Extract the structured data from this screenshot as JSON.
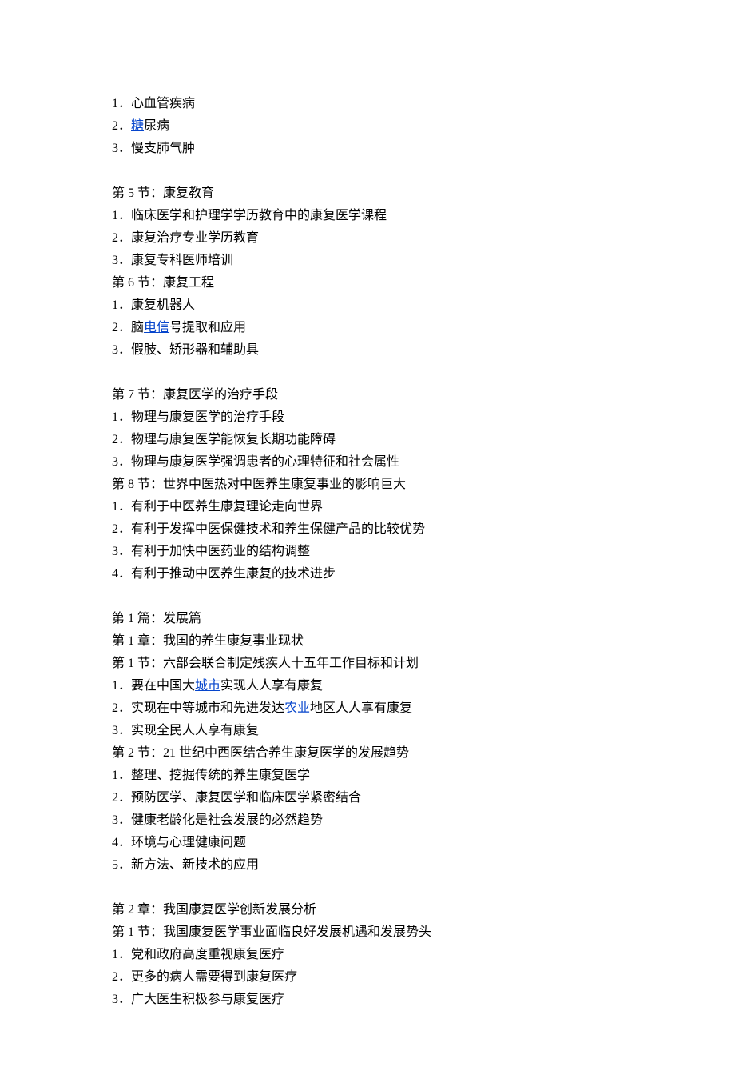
{
  "items": {
    "i1": {
      "pre": "1．",
      "text": "心血管疾病"
    },
    "i2": {
      "pre": "2．",
      "link": "糖",
      "text": "尿病"
    },
    "i3": {
      "pre": "3．",
      "text": "慢支肺气肿"
    },
    "s5": "第 5 节：康复教育",
    "s5_1": {
      "pre": "1．",
      "text": "临床医学和护理学学历教育中的康复医学课程"
    },
    "s5_2": {
      "pre": "2．",
      "text": "康复治疗专业学历教育"
    },
    "s5_3": {
      "pre": "3．",
      "text": "康复专科医师培训"
    },
    "s6": "第 6 节：康复工程",
    "s6_1": {
      "pre": "1．",
      "text": "康复机器人"
    },
    "s6_2": {
      "pre": "2．",
      "preText": "脑",
      "link": "电信",
      "text": "号提取和应用"
    },
    "s6_3": {
      "pre": "3．",
      "text": "假肢、矫形器和辅助具"
    },
    "s7": "第 7 节：康复医学的治疗手段",
    "s7_1": {
      "pre": "1．",
      "text": "物理与康复医学的治疗手段"
    },
    "s7_2": {
      "pre": "2．",
      "text": "物理与康复医学能恢复长期功能障碍"
    },
    "s7_3": {
      "pre": "3．",
      "text": "物理与康复医学强调患者的心理特征和社会属性"
    },
    "s8": "第 8 节：世界中医热对中医养生康复事业的影响巨大",
    "s8_1": {
      "pre": "1．",
      "text": "有利于中医养生康复理论走向世界"
    },
    "s8_2": {
      "pre": "2．",
      "text": "有利于发挥中医保健技术和养生保健产品的比较优势"
    },
    "s8_3": {
      "pre": "3．",
      "text": "有利于加快中医药业的结构调整"
    },
    "s8_4": {
      "pre": "4．",
      "text": "有利于推动中医养生康复的技术进步"
    },
    "p1": "第 1 篇：发展篇",
    "c1": "第 1 章：我国的养生康复事业现状",
    "c1s1": "第 1 节：六部会联合制定残疾人十五年工作目标和计划",
    "c1s1_1": {
      "pre": "1．",
      "preText": "要在中国大",
      "link": "城市",
      "text": "实现人人享有康复"
    },
    "c1s1_2": {
      "pre": "2．",
      "preText": "实现在中等城市和先进发达",
      "link": "农业",
      "text": "地区人人享有康复"
    },
    "c1s1_3": {
      "pre": "3．",
      "text": "实现全民人人享有康复"
    },
    "c1s2": "第 2 节：21 世纪中西医结合养生康复医学的发展趋势",
    "c1s2_1": {
      "pre": "1．",
      "text": "整理、挖掘传统的养生康复医学"
    },
    "c1s2_2": {
      "pre": "2．",
      "text": "预防医学、康复医学和临床医学紧密结合"
    },
    "c1s2_3": {
      "pre": "3．",
      "text": "健康老龄化是社会发展的必然趋势"
    },
    "c1s2_4": {
      "pre": "4．",
      "text": "环境与心理健康问题"
    },
    "c1s2_5": {
      "pre": "5．",
      "text": "新方法、新技术的应用"
    },
    "c2": "第 2 章：我国康复医学创新发展分析",
    "c2s1": "第 1 节：我国康复医学事业面临良好发展机遇和发展势头",
    "c2s1_1": {
      "pre": "1．",
      "text": "党和政府高度重视康复医疗"
    },
    "c2s1_2": {
      "pre": "2．",
      "text": "更多的病人需要得到康复医疗"
    },
    "c2s1_3": {
      "pre": "3．",
      "text": "广大医生积极参与康复医疗"
    }
  }
}
